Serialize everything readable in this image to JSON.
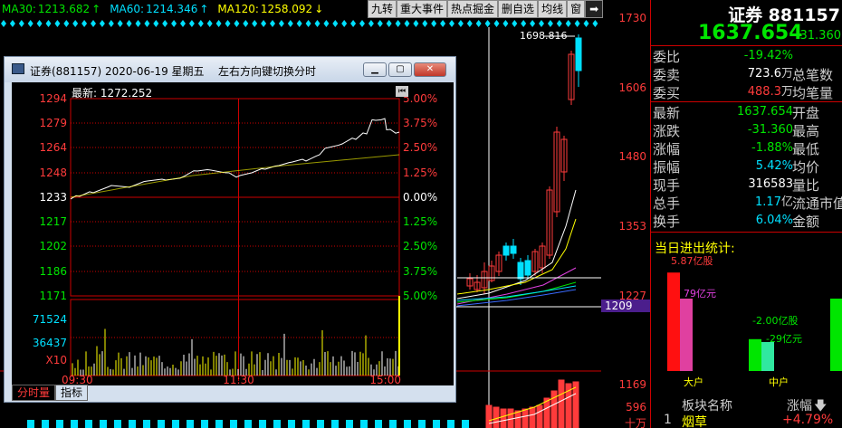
{
  "ma_bar": [
    {
      "label": "MA30:",
      "value": "1213.682",
      "arrow": "↑",
      "color": "#00e600"
    },
    {
      "label": "MA60:",
      "value": "1214.346",
      "arrow": "↑",
      "color": "#00e0ff"
    },
    {
      "label": "MA120:",
      "value": "1258.092",
      "arrow": "↓",
      "color": "#ffff00"
    }
  ],
  "toolbar": {
    "buttons": [
      "九转",
      "重大事件",
      "热点掘金",
      "删自选",
      "均线",
      "窗"
    ],
    "arrow_icon": "arrow-right-icon"
  },
  "main_chart": {
    "y_ticks": [
      "1730",
      "1606",
      "1480",
      "1353",
      "1227",
      "1209",
      "1169",
      "596",
      "十万"
    ],
    "high_label": "1698.816",
    "current_marker": "1209"
  },
  "quote": {
    "name": "证券 881157",
    "price": "1637.654",
    "change": "-31.360",
    "rows": [
      {
        "label": "委比",
        "value": "-19.42%",
        "value_color": "#00e600",
        "right": "",
        "unit": ""
      },
      {
        "label": "委卖",
        "value": "723.6",
        "unit": "万",
        "value_color": "#ffffff",
        "right": "总笔数"
      },
      {
        "label": "委买",
        "value": "488.3",
        "unit": "万",
        "value_color": "#ff3b3b",
        "right": "均笔量"
      },
      {
        "label": "最新",
        "value": "1637.654",
        "unit": "",
        "value_color": "#00e600",
        "right": "开盘"
      },
      {
        "label": "涨跌",
        "value": "-31.360",
        "unit": "",
        "value_color": "#00e600",
        "right": "最高"
      },
      {
        "label": "涨幅",
        "value": "-1.88%",
        "unit": "",
        "value_color": "#00e600",
        "right": "最低"
      },
      {
        "label": "振幅",
        "value": "5.42%",
        "unit": "",
        "value_color": "#00e0ff",
        "right": "均价"
      },
      {
        "label": "现手",
        "value": "316583",
        "unit": "",
        "value_color": "#ffffff",
        "right": "量比"
      },
      {
        "label": "总手",
        "value": "1.17",
        "unit": "亿",
        "value_color": "#00e0ff",
        "right": "流通市值"
      },
      {
        "label": "换手",
        "value": "6.04%",
        "unit": "",
        "value_color": "#00e0ff",
        "right": "金额"
      }
    ]
  },
  "flow": {
    "title": "当日进出统计:",
    "big_in": "5.87亿股",
    "big_out": "79亿元",
    "mid_in": "-2.00亿股",
    "mid_out": "-29亿元",
    "big_label": "大户",
    "mid_label": "中户",
    "big_in_level": 0.68,
    "big_out_level": 0.5,
    "mid_in_level": 0.22,
    "mid_out_level": 0.2,
    "small_level": 0.5
  },
  "sector": {
    "header_name": "板块名称",
    "header_change": "涨幅",
    "header_sort_icon": "sort-down-icon",
    "row_index": "1",
    "row_name": "烟草",
    "row_change": "+4.79%"
  },
  "popup": {
    "title": "证券(881157) 2020-06-19 星期五",
    "hint": "左右方向键切换分时",
    "latest_label": "最新: 1272.252",
    "min_btn": "minimize-icon",
    "max_btn": "maximize-icon",
    "close_btn": "close-icon",
    "back_icon": "jump-back-icon",
    "tabs": [
      "分时量",
      "指标"
    ],
    "price_ticks": [
      "1294",
      "1279",
      "1264",
      "1248",
      "1233",
      "1217",
      "1202",
      "1186",
      "1171"
    ],
    "pct_ticks": [
      "5.00%",
      "3.75%",
      "2.50%",
      "1.25%",
      "0.00%",
      "1.25%",
      "2.50%",
      "3.75%",
      "5.00%"
    ],
    "vol_ticks": [
      "71524",
      "36437",
      "X10"
    ],
    "time_ticks": [
      "09:30",
      "11:30",
      "15:00"
    ]
  }
}
